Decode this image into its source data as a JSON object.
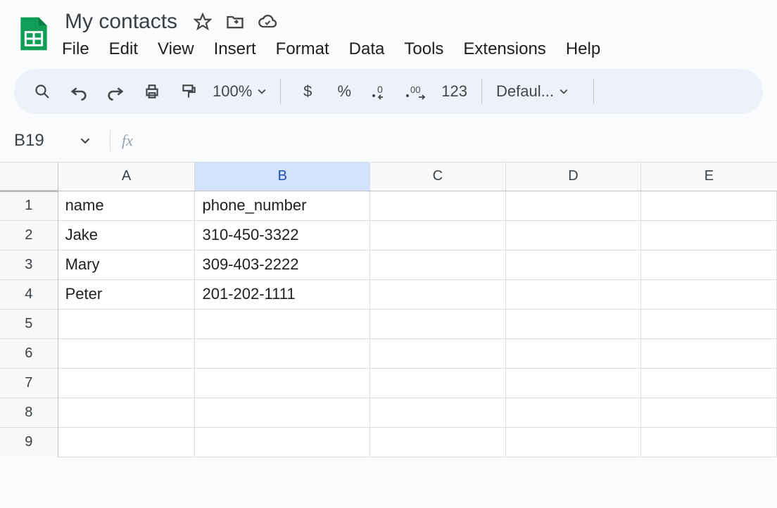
{
  "doc": {
    "title": "My contacts"
  },
  "menu": {
    "file": "File",
    "edit": "Edit",
    "view": "View",
    "insert": "Insert",
    "format": "Format",
    "data": "Data",
    "tools": "Tools",
    "extensions": "Extensions",
    "help": "Help"
  },
  "toolbar": {
    "zoom": "100%",
    "currency": "$",
    "percent": "%",
    "number_format": "123",
    "font": "Defaul..."
  },
  "namebox": {
    "cell_ref": "B19",
    "fx": "fx"
  },
  "columns": [
    "A",
    "B",
    "C",
    "D",
    "E"
  ],
  "selected_column": "B",
  "visible_rows": 9,
  "cells": {
    "A1": "name",
    "B1": "phone_number",
    "A2": "Jake",
    "B2": "310-450-3322",
    "A3": "Mary",
    "B3": "309-403-2222",
    "A4": "Peter",
    "B4": "201-202-1111"
  }
}
